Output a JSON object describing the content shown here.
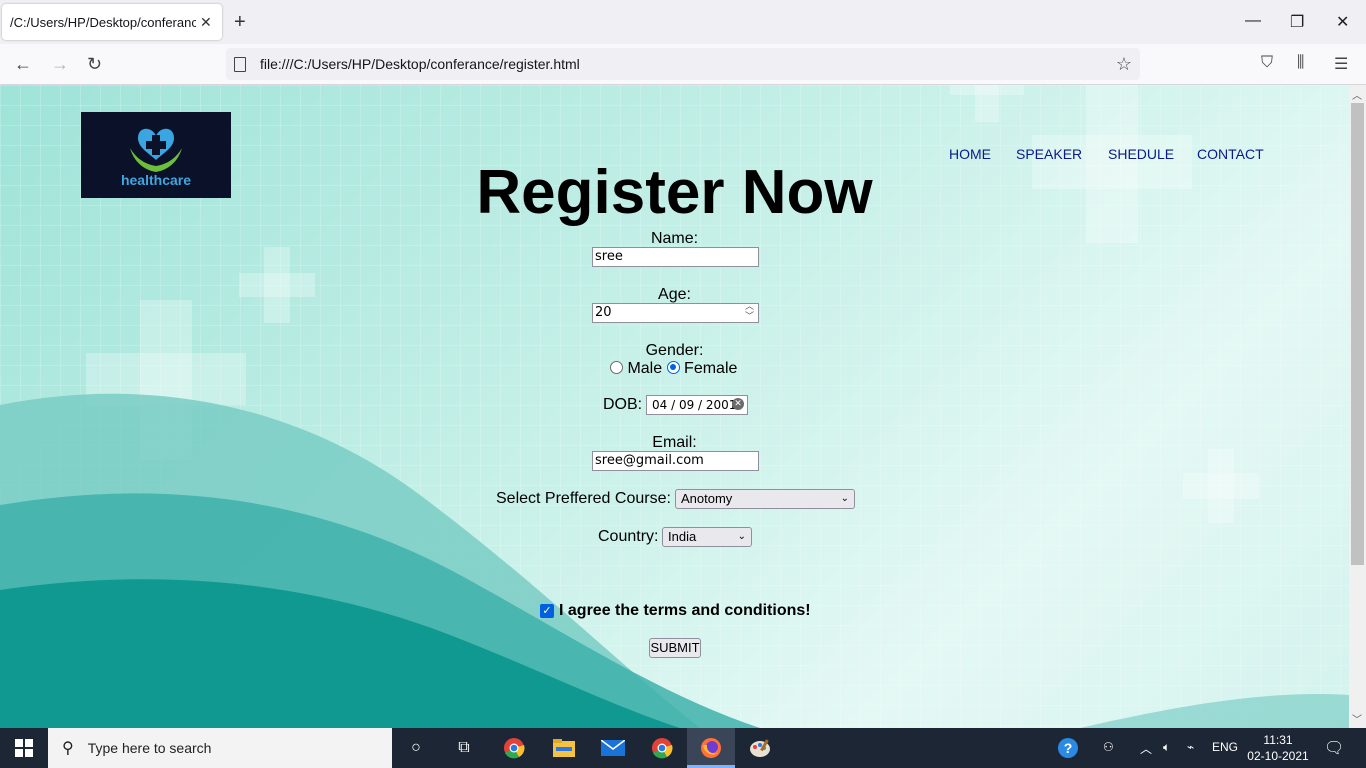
{
  "browser": {
    "tab_title": "/C:/Users/HP/Desktop/conferance/r",
    "url": "file:///C:/Users/HP/Desktop/conferance/register.html"
  },
  "page": {
    "logo_text": "healthcare",
    "nav": [
      "HOME",
      "SPEAKER",
      "SHEDULE",
      "CONTACT"
    ],
    "title": "Register Now",
    "form": {
      "name_label": "Name:",
      "name_value": "sree",
      "age_label": "Age:",
      "age_value": "20",
      "gender_label": "Gender:",
      "gender_options": [
        "Male",
        "Female"
      ],
      "gender_selected": "Female",
      "dob_label": "DOB:",
      "dob_value": "04 / 09 / 2001",
      "email_label": "Email:",
      "email_value": "sree@gmail.com",
      "course_label": "Select Preffered Course:",
      "course_value": "Anotomy",
      "country_label": "Country:",
      "country_value": "India",
      "terms_label": "I agree the terms and conditions!",
      "terms_checked": true,
      "submit_label": "SUBMIT"
    }
  },
  "taskbar": {
    "search_placeholder": "Type here to search",
    "language": "ENG",
    "time": "11:31",
    "date": "02-10-2021"
  },
  "colors": {
    "nav_link": "#0a1a8a",
    "accent": "#0060df",
    "taskbar": "#1c2635"
  }
}
